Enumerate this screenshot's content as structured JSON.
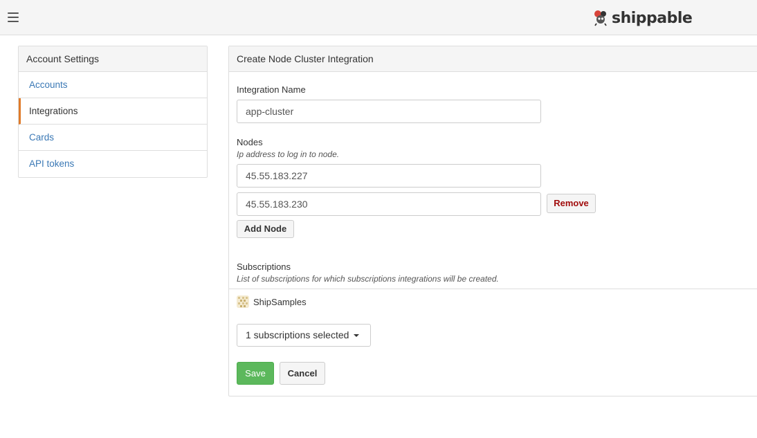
{
  "header": {
    "brand": "shippable",
    "menu_icon": "hamburger-menu-icon",
    "logo_icon": "shippable-logo-icon"
  },
  "sidebar": {
    "title": "Account Settings",
    "items": [
      {
        "label": "Accounts",
        "active": false
      },
      {
        "label": "Integrations",
        "active": true
      },
      {
        "label": "Cards",
        "active": false
      },
      {
        "label": "API tokens",
        "active": false
      }
    ]
  },
  "form": {
    "title": "Create Node Cluster Integration",
    "integration_name": {
      "label": "Integration Name",
      "value": "app-cluster"
    },
    "nodes": {
      "label": "Nodes",
      "help": "Ip address to log in to node.",
      "values": [
        "45.55.183.227",
        "45.55.183.230"
      ],
      "remove_label": "Remove",
      "add_label": "Add Node"
    },
    "subscriptions": {
      "label": "Subscriptions",
      "help": "List of subscriptions for which subscriptions integrations will be created.",
      "item": "ShipSamples",
      "selector": "1 subscriptions selected"
    },
    "save_label": "Save",
    "cancel_label": "Cancel"
  },
  "colors": {
    "link": "#3a78b5",
    "active_marker": "#e07b2a",
    "remove_text": "#a10d0d",
    "save_bg": "#5cb85c"
  }
}
